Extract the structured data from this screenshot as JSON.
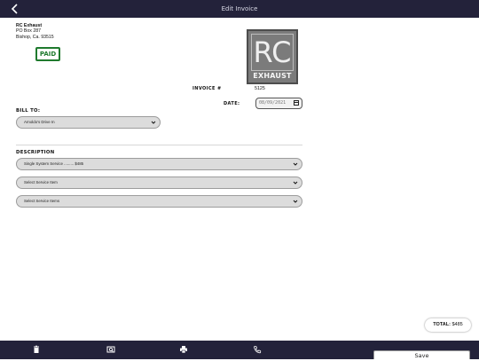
{
  "header": {
    "title": "Edit Invoice",
    "back_icon": "chevron-left-icon"
  },
  "company": {
    "name": "RC Exhaust",
    "address1": "PO Box 287",
    "address2": "Bishop, Ca. 93515"
  },
  "status_badge": "PAID",
  "logo": {
    "initials": "RC",
    "word": "EXHAUST"
  },
  "invoice": {
    "number_label": "INVOICE #",
    "number": "5125",
    "date_label": "DATE:",
    "date_value": "08/09/2021"
  },
  "bill_to": {
    "label": "BILL TO:",
    "selected": "Arnoldo's Drive In"
  },
  "description": {
    "label": "DESCRIPTION",
    "items": [
      {
        "selected": "Single System Service ......... $485"
      },
      {
        "selected": "Select Service Item"
      },
      {
        "selected": "Select Service Items"
      }
    ]
  },
  "total": {
    "label": "TOTAL:",
    "value": "$485"
  },
  "toolbar": {
    "icons": [
      "trash-icon",
      "preview-icon",
      "print-icon",
      "phone-icon"
    ],
    "save_label": "Save"
  },
  "colors": {
    "bar": "#23223a",
    "paid": "#1f7a2e",
    "select_bg": "#dcdcdc"
  }
}
